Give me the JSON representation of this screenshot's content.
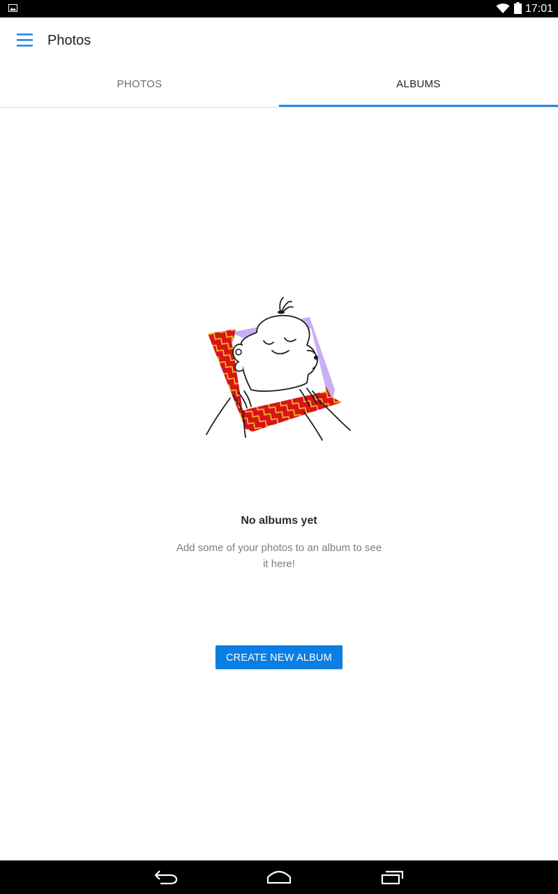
{
  "status_bar": {
    "time": "17:01",
    "icons": [
      "picture-notification-icon",
      "wifi-icon",
      "battery-icon"
    ]
  },
  "app_bar": {
    "title": "Photos",
    "menu_icon": "hamburger-menu-icon"
  },
  "tabs": [
    {
      "label": "PHOTOS",
      "selected": false
    },
    {
      "label": "ALBUMS",
      "selected": true
    }
  ],
  "empty_state": {
    "illustration": "character-holding-photo-frame",
    "title": "No albums yet",
    "message": "Add some of your photos to an album to see it here!",
    "button_label": "CREATE NEW ALBUM"
  },
  "nav_bar": {
    "icons": [
      "back-icon",
      "home-icon",
      "recents-icon"
    ]
  },
  "colors": {
    "accent": "#1e88e5",
    "button": "#0a7ee2",
    "frame_red": "#d8141d",
    "frame_yellow": "#f5c518",
    "frame_lavender": "#c9aef5"
  }
}
